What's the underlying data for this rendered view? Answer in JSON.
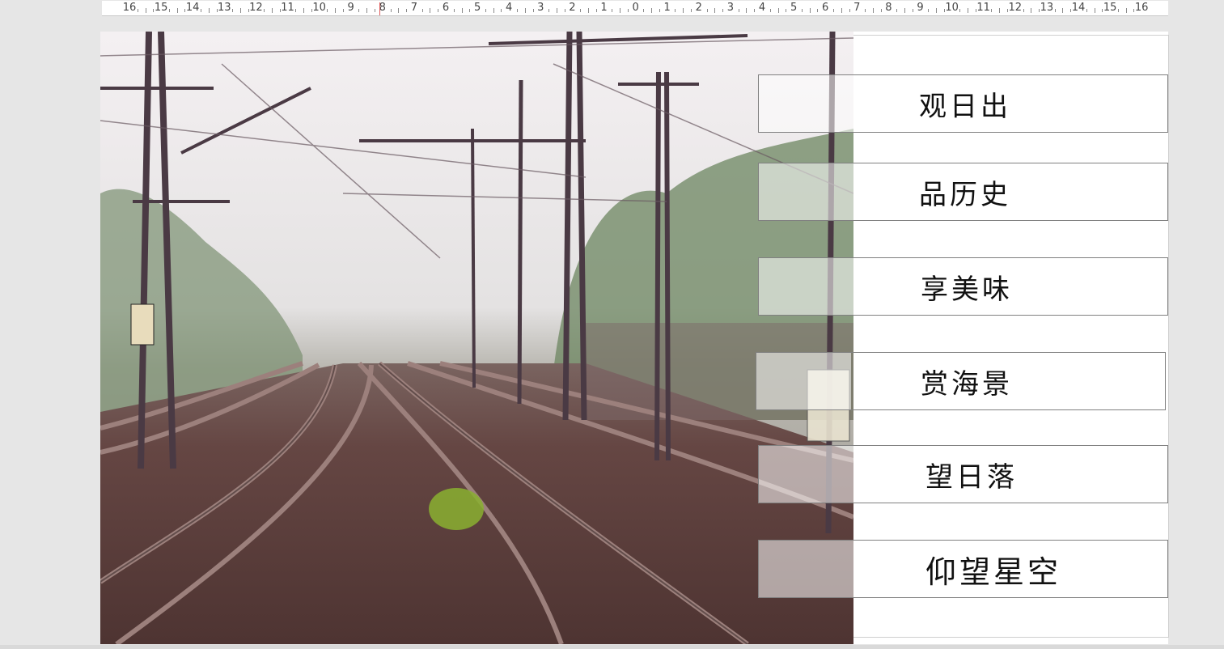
{
  "ruler": {
    "labels": [
      "16",
      "15",
      "14",
      "13",
      "12",
      "11",
      "10",
      "9",
      "8",
      "7",
      "6",
      "5",
      "4",
      "3",
      "2",
      "1",
      "0",
      "1",
      "2",
      "3",
      "4",
      "5",
      "6",
      "7",
      "8",
      "9",
      "10",
      "11",
      "12",
      "13",
      "14",
      "15",
      "16"
    ]
  },
  "slide": {
    "photo_alt": "railway tracks with overhead catenary masts",
    "items": [
      {
        "label": "观日出"
      },
      {
        "label": "品历史"
      },
      {
        "label": "享美味"
      },
      {
        "label": "赏海景"
      },
      {
        "label": "望日落"
      },
      {
        "label": "仰望星空"
      }
    ]
  },
  "colors": {
    "ballast": "#5b3f3c",
    "rail": "#8a6a66",
    "mast": "#4a3a44",
    "sky": "#f3eef0",
    "foliage": "#5f7a55"
  }
}
